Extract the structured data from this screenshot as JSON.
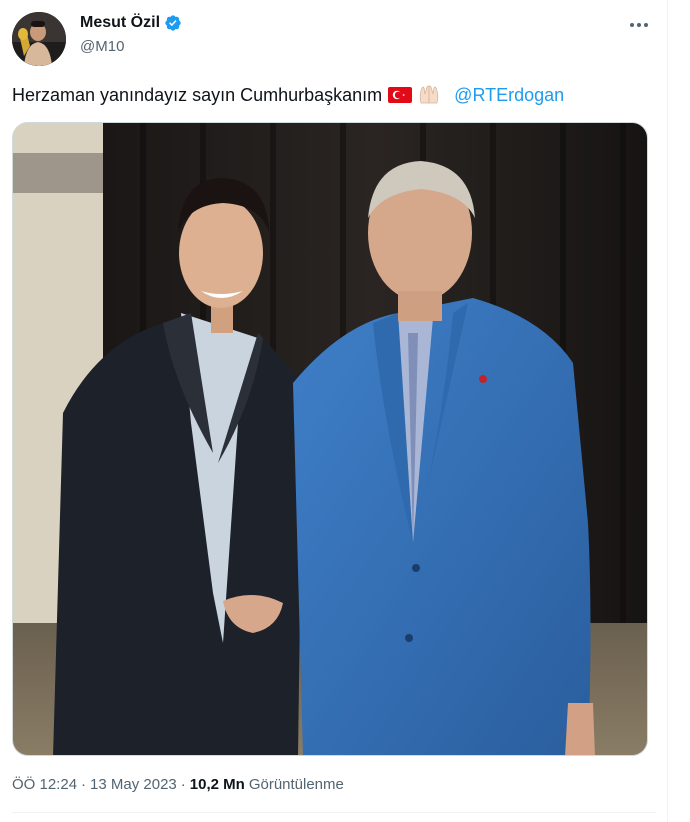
{
  "author": {
    "display_name": "Mesut Özil",
    "handle": "@M10",
    "verified": true
  },
  "tweet": {
    "text": "Herzaman yanındayız sayın Cumhurbaşkanım",
    "emojis": [
      "turkey-flag",
      "palms-up-together"
    ],
    "mention": "@RTErdogan"
  },
  "meta": {
    "time": "ÖÖ 12:24",
    "separator": "·",
    "date": "13 May 2023",
    "views_count": "10,2 Mn",
    "views_label": "Görüntülenme"
  },
  "colors": {
    "accent": "#1d9bf0",
    "secondary_text": "#536471",
    "primary_text": "#0f1419"
  },
  "icons": {
    "verified": "verified-badge-icon",
    "more": "more-horizontal-icon"
  }
}
